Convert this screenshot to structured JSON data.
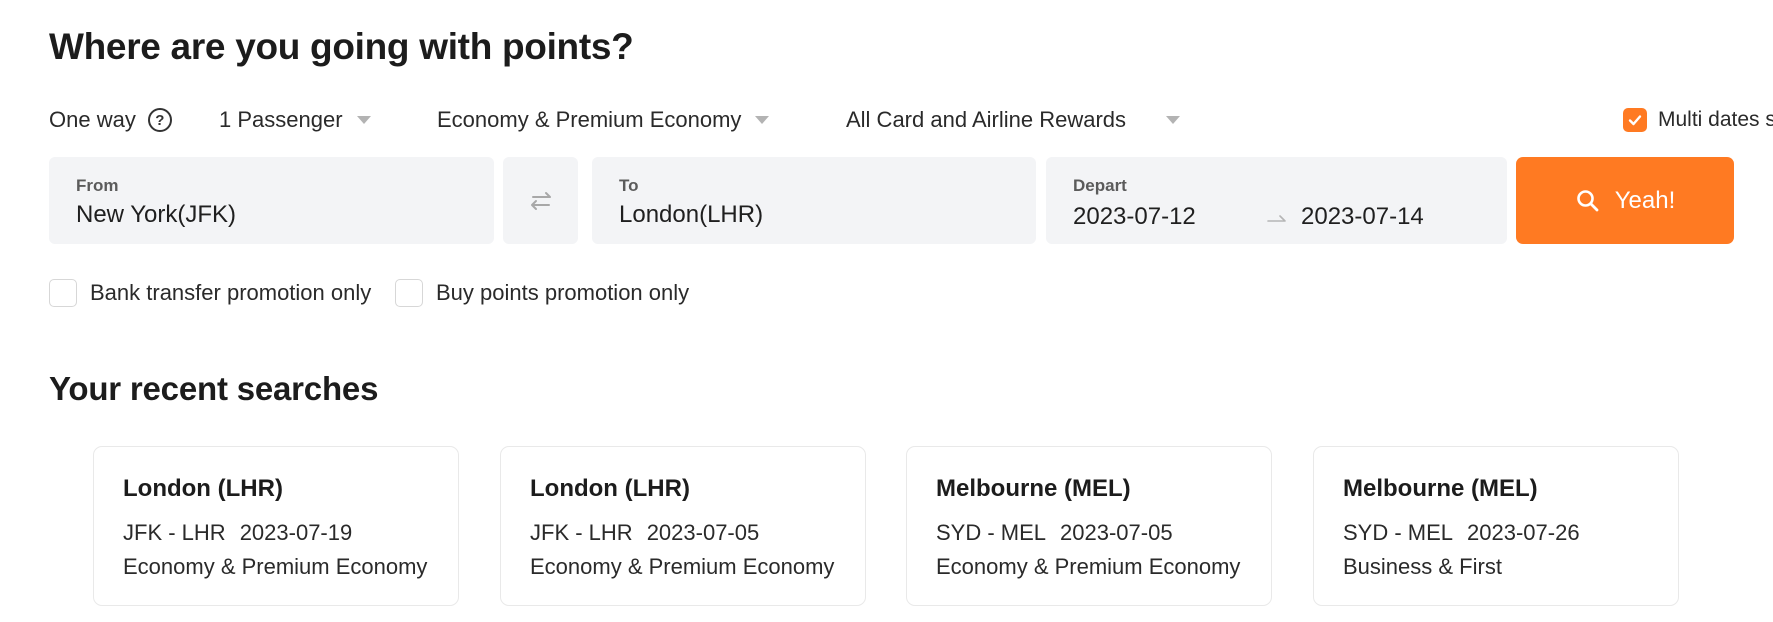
{
  "page": {
    "title": "Where are you going with points?"
  },
  "options": {
    "trip_type": "One way",
    "passengers": "1 Passenger",
    "cabin": "Economy & Premium Economy",
    "rewards": "All Card and Airline Rewards",
    "multi_dates_label": "Multi dates search",
    "multi_dates_checked": true
  },
  "search": {
    "from_label": "From",
    "from_value": "New York(JFK)",
    "to_label": "To",
    "to_value": "London(LHR)",
    "depart_label": "Depart",
    "depart_start": "2023-07-12",
    "depart_end": "2023-07-14",
    "submit_label": "Yeah!"
  },
  "filters": {
    "bank_transfer_label": "Bank transfer promotion only",
    "buy_points_label": "Buy points promotion only"
  },
  "recent": {
    "heading": "Your recent searches",
    "items": [
      {
        "city": "London (LHR)",
        "route": "JFK - LHR",
        "date": "2023-07-19",
        "cabin": "Economy & Premium Economy"
      },
      {
        "city": "London (LHR)",
        "route": "JFK - LHR",
        "date": "2023-07-05",
        "cabin": "Economy & Premium Economy"
      },
      {
        "city": "Melbourne (MEL)",
        "route": "SYD - MEL",
        "date": "2023-07-05",
        "cabin": "Economy & Premium Economy"
      },
      {
        "city": "Melbourne (MEL)",
        "route": "SYD - MEL",
        "date": "2023-07-26",
        "cabin": "Business & First"
      }
    ]
  },
  "colors": {
    "accent": "#ff7a22",
    "field_bg": "#f3f4f6",
    "text": "#1f1f1f"
  },
  "icons": {
    "help": "question-circle-icon",
    "caret": "caret-down-icon",
    "check": "check-icon",
    "swap": "swap-arrows-icon",
    "range": "arrow-right-icon",
    "search": "search-icon"
  }
}
